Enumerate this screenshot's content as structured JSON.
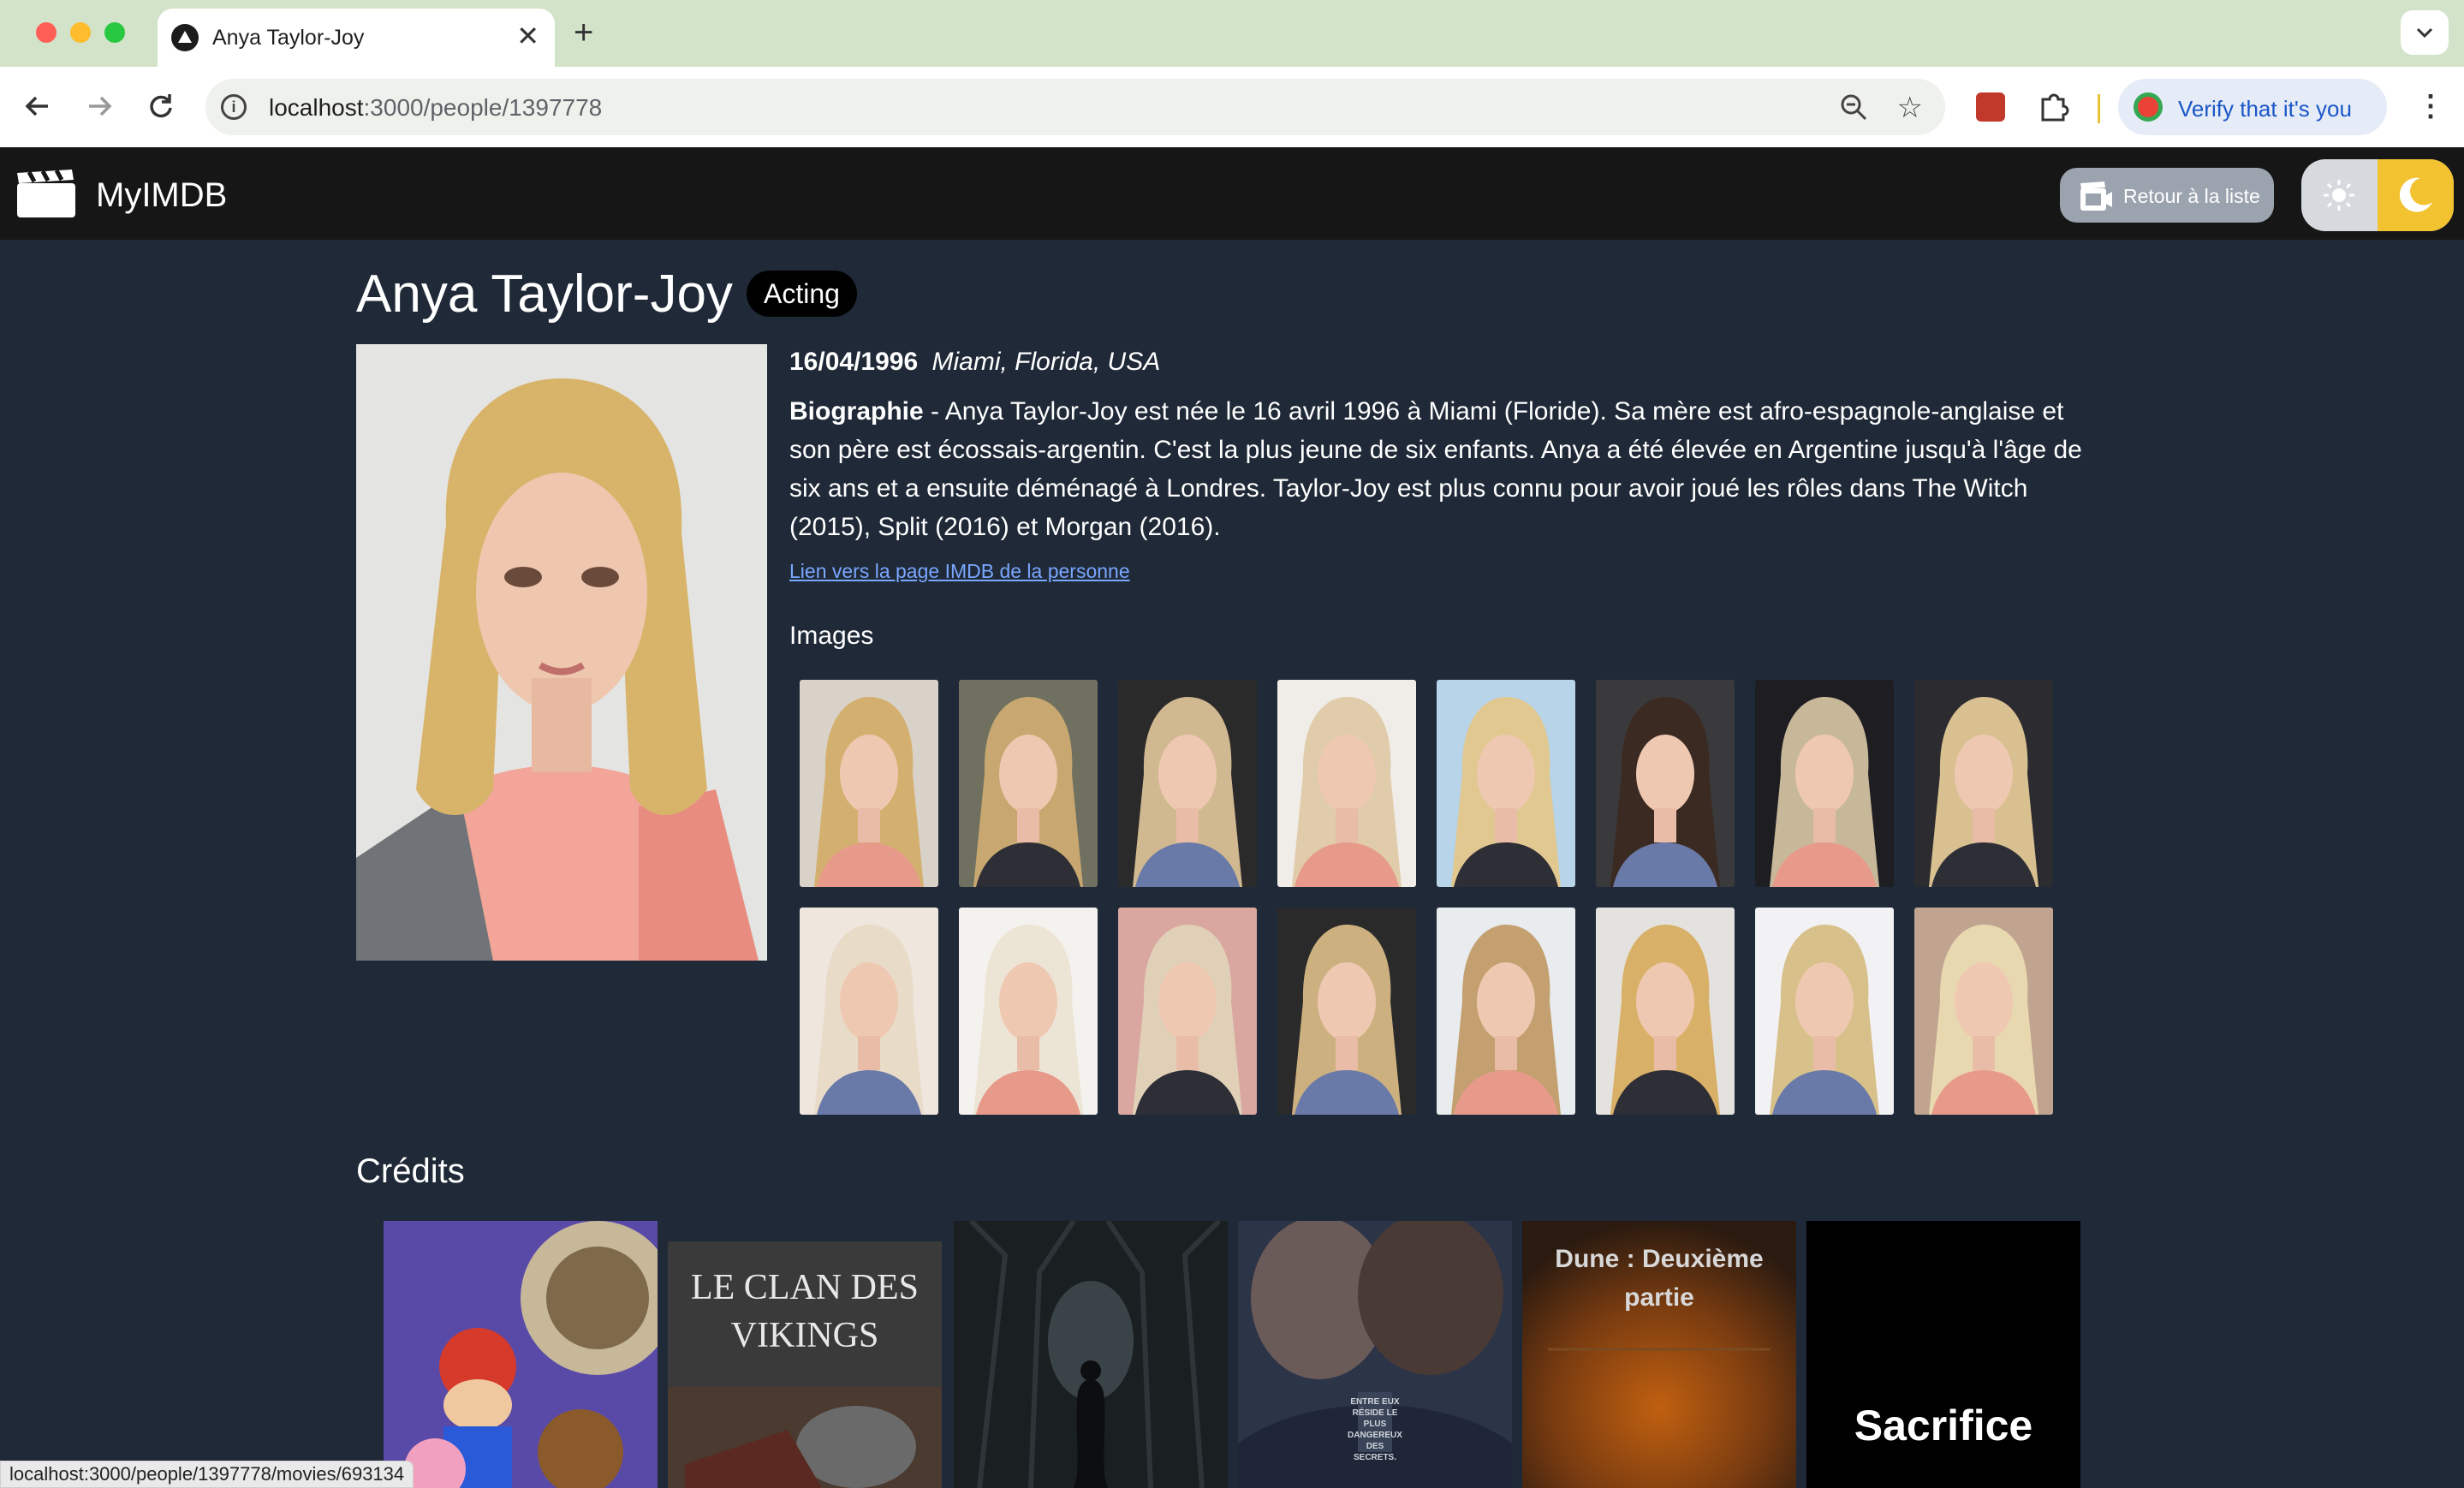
{
  "browser": {
    "tab_title": "Anya Taylor-Joy",
    "tab_close": "✕",
    "new_tab": "+",
    "url_host": "localhost",
    "url_rest": ":3000/people/1397778",
    "verify_label": "Verify that it's you",
    "menu_glyph": "⋮",
    "status_url": "localhost:3000/people/1397778/movies/693134"
  },
  "header": {
    "brand": "MyIMDB",
    "back_label": "Retour à la liste"
  },
  "person": {
    "name": "Anya Taylor-Joy",
    "department": "Acting",
    "birthday": "16/04/1996",
    "birthplace": "Miami, Florida, USA",
    "bio_label": "Biographie",
    "bio_text": " - Anya Taylor-Joy est née le 16 avril 1996 à Miami (Floride). Sa mère est afro-espagnole-anglaise et son père est écossais-argentin. C'est la plus jeune de six enfants. Anya a été élevée en Argentine jusqu'à l'âge de six ans et a ensuite déménagé à Londres. Taylor-Joy est plus connu pour avoir joué les rôles dans The Witch (2015), Split (2016) et Morgan (2016).",
    "imdb_link": "Lien vers la page IMDB de la personne"
  },
  "images": {
    "title": "Images",
    "count": 16
  },
  "credits": {
    "title": "Crédits",
    "posters": [
      {
        "text": ""
      },
      {
        "text": "LE CLAN DES VIKINGS"
      },
      {
        "text": ""
      },
      {
        "text": "ENTRE EUX RÉSIDE LE PLUS DANGEREUX DES SECRETS."
      },
      {
        "text": "Dune : Deuxième partie"
      },
      {
        "text": "Sacrifice"
      }
    ]
  }
}
